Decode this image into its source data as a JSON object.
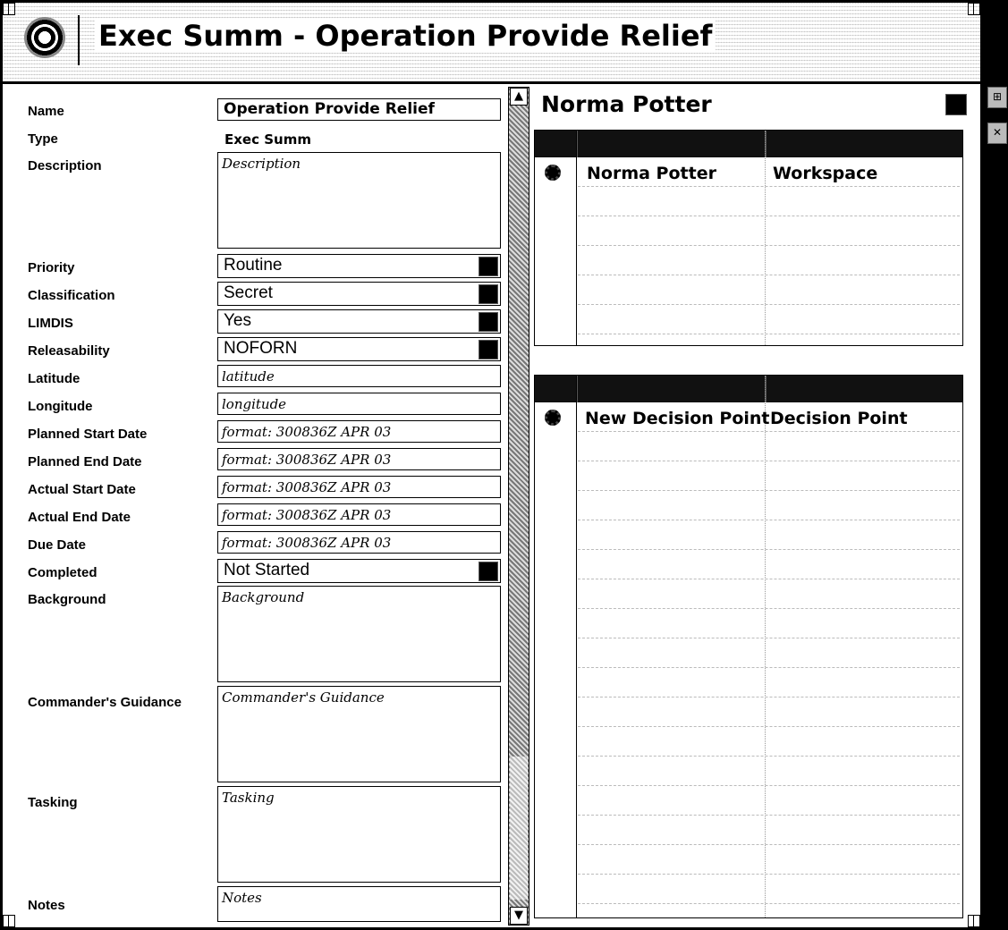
{
  "window": {
    "title": "Exec Summ - Operation Provide Relief"
  },
  "form": {
    "name_label": "Name",
    "name_value": "Operation Provide Relief",
    "type_label": "Type",
    "type_value": "Exec Summ",
    "description_label": "Description",
    "description_placeholder": "Description",
    "priority_label": "Priority",
    "priority_value": "Routine",
    "classification_label": "Classification",
    "classification_value": "Secret",
    "limdis_label": "LIMDIS",
    "limdis_value": "Yes",
    "releasability_label": "Releasability",
    "releasability_value": "NOFORN",
    "latitude_label": "Latitude",
    "latitude_placeholder": "latitude",
    "longitude_label": "Longitude",
    "longitude_placeholder": "longitude",
    "planned_start_label": "Planned Start Date",
    "planned_start_placeholder": "format: 300836Z APR 03",
    "planned_end_label": "Planned End Date",
    "planned_end_placeholder": "format: 300836Z APR 03",
    "actual_start_label": "Actual Start Date",
    "actual_start_placeholder": "format: 300836Z APR 03",
    "actual_end_label": "Actual End Date",
    "actual_end_placeholder": "format: 300836Z APR 03",
    "due_label": "Due Date",
    "due_placeholder": "format: 300836Z APR 03",
    "completed_label": "Completed",
    "completed_value": "Not Started",
    "background_label": "Background",
    "background_placeholder": "Background",
    "guidance_label": "Commander's Guidance",
    "guidance_placeholder": "Commander's Guidance",
    "tasking_label": "Tasking",
    "tasking_placeholder": "Tasking",
    "notes_label": "Notes",
    "notes_placeholder": "Notes"
  },
  "right_panel": {
    "owner_title": "Norma Potter",
    "workspace_table": {
      "name": "Norma Potter",
      "type": "Workspace"
    },
    "decision_table": {
      "name": "New Decision Point",
      "type": "Decision Point"
    }
  },
  "side_buttons": [
    "⊞",
    "✕"
  ]
}
